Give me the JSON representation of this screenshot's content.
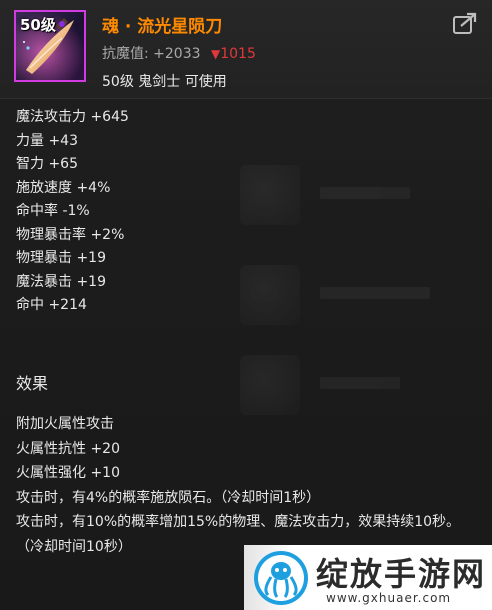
{
  "item": {
    "level_badge": "50级",
    "name": "魂 · 流光星陨刀",
    "resist_label": "抗魔值:",
    "resist_value": "+2033",
    "resist_diff_arrow": "▼",
    "resist_diff": "1015",
    "requirement": "50级 鬼剑士 可使用",
    "icon": "sword-icon",
    "rarity_color": "#d23be0",
    "name_color": "#ff8a00",
    "diff_color": "#e3383a"
  },
  "share_button": {
    "icon": "share-icon"
  },
  "stats": [
    "魔法攻击力 +645",
    "力量 +43",
    "智力 +65",
    "施放速度 +4%",
    "命中率 -1%",
    "物理暴击率 +2%",
    "物理暴击 +19",
    "魔法暴击 +19",
    "命中 +214"
  ],
  "effects": {
    "title": "效果",
    "lines": [
      "附加火属性攻击",
      "火属性抗性 +20",
      "火属性强化 +10",
      "攻击时，有4%的概率施放陨石。（冷却时间1秒）",
      "攻击时，有10%的概率增加15%的物理、魔法攻击力，效果持续10秒。（冷却时间10秒）"
    ]
  },
  "watermark": {
    "title": "绽放手游网",
    "url": "www.gxhuaer.com",
    "icon": "octopus-logo-icon"
  }
}
